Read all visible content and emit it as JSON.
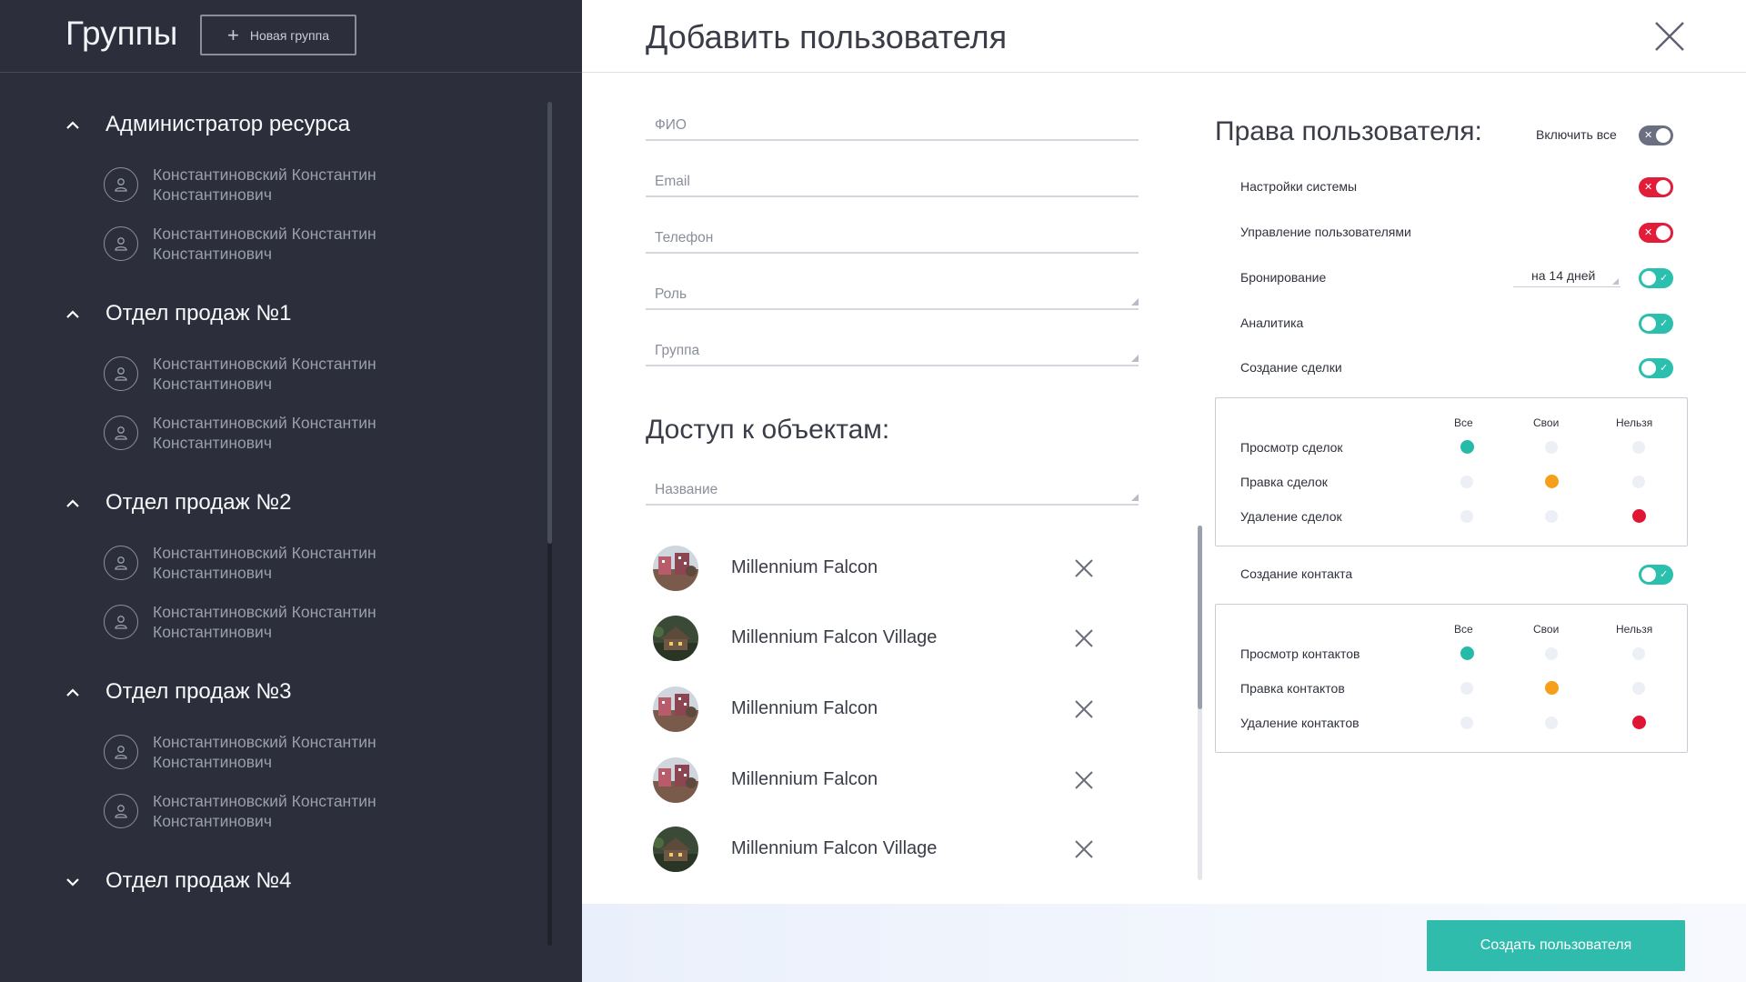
{
  "sidebar": {
    "title": "Группы",
    "new_group_label": "Новая группа",
    "groups": [
      {
        "name": "Администратор ресурса",
        "expanded": true,
        "members": [
          "Константиновский Константин Константинович",
          "Константиновский Константин Константинович"
        ]
      },
      {
        "name": "Отдел продаж №1",
        "expanded": true,
        "members": [
          "Константиновский Константин Константинович",
          "Константиновский Константин Константинович"
        ]
      },
      {
        "name": "Отдел продаж №2",
        "expanded": true,
        "members": [
          "Константиновский Константин Константинович",
          "Константиновский Константин Константинович"
        ]
      },
      {
        "name": "Отдел продаж №3",
        "expanded": true,
        "members": [
          "Константиновский Константин Константинович",
          "Константиновский Константин Константинович"
        ]
      },
      {
        "name": "Отдел продаж №4",
        "expanded": false,
        "members": []
      }
    ]
  },
  "modal": {
    "title": "Добавить пользователя",
    "fields": {
      "fio": {
        "placeholder": "ФИО",
        "value": ""
      },
      "email": {
        "placeholder": "Email",
        "value": ""
      },
      "phone": {
        "placeholder": "Телефон",
        "value": ""
      },
      "role": {
        "placeholder": "Роль",
        "value": ""
      },
      "group": {
        "placeholder": "Группа",
        "value": ""
      }
    },
    "access": {
      "title": "Доступ к объектам:",
      "name_placeholder": "Название",
      "objects": [
        {
          "name": "Millennium Falcon",
          "thumb": "building-photo-pink"
        },
        {
          "name": "Millennium Falcon Village",
          "thumb": "building-photo-green"
        },
        {
          "name": "Millennium Falcon",
          "thumb": "building-photo-pink"
        },
        {
          "name": "Millennium Falcon",
          "thumb": "building-photo-pink"
        },
        {
          "name": "Millennium Falcon Village",
          "thumb": "building-photo-green"
        }
      ]
    },
    "rights": {
      "title": "Права пользователя:",
      "enable_all_label": "Включить все",
      "enable_all": false,
      "items": [
        {
          "label": "Настройки системы",
          "enabled": false
        },
        {
          "label": "Управление пользователями",
          "enabled": false
        },
        {
          "label": "Бронирование",
          "enabled": true,
          "select_value": "на 14 дней"
        },
        {
          "label": "Аналитика",
          "enabled": true
        },
        {
          "label": "Создание сделки",
          "enabled": true
        }
      ],
      "deals_matrix": {
        "columns": [
          "Все",
          "Свои",
          "Нельзя"
        ],
        "rows": [
          {
            "label": "Просмотр сделок",
            "selected": "Все"
          },
          {
            "label": "Правка сделок",
            "selected": "Свои"
          },
          {
            "label": "Удаление сделок",
            "selected": "Нельзя"
          }
        ]
      },
      "contact_toggle": {
        "label": "Создание контакта",
        "enabled": true
      },
      "contacts_matrix": {
        "columns": [
          "Все",
          "Свои",
          "Нельзя"
        ],
        "rows": [
          {
            "label": "Просмотр контактов",
            "selected": "Все"
          },
          {
            "label": "Правка контактов",
            "selected": "Свои"
          },
          {
            "label": "Удаление контактов",
            "selected": "Нельзя"
          }
        ]
      }
    },
    "submit_label": "Создать пользователя"
  },
  "colors": {
    "sidebar_bg": "#2c2f3b",
    "accent_teal": "#2fbcad",
    "toggle_off_red": "#e11d3a",
    "toggle_off_grey": "#6b7080",
    "radio_orange": "#f59f1b"
  }
}
